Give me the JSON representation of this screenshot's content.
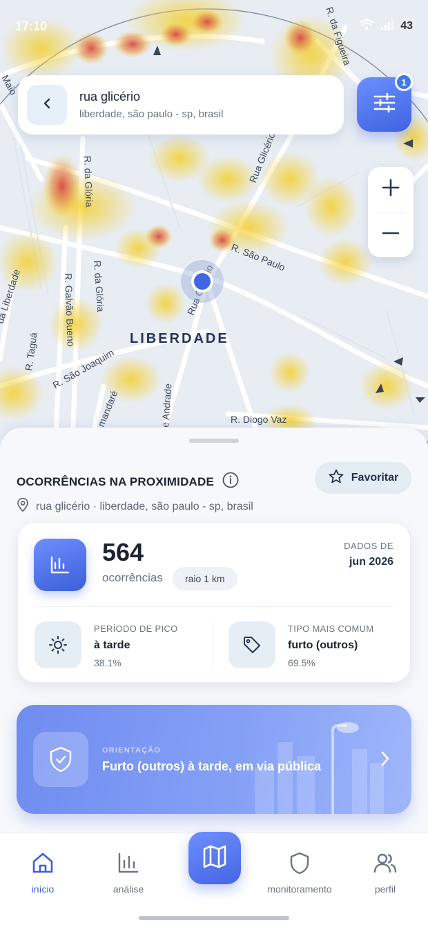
{
  "status": {
    "time": "17:10",
    "battery": "43"
  },
  "search": {
    "title": "rua glicério",
    "subtitle": "liberdade, são paulo - sp, brasil"
  },
  "filter": {
    "badge": "1"
  },
  "map": {
    "district": "LIBERDADE",
    "streets": [
      "R. da Figueira",
      "Maio",
      "R. da Glória",
      "Rua Glicério",
      "R. São Paulo",
      "Rua Glicério",
      "R. Galvão Bueno",
      "R. da Glória",
      "da Liberdade",
      "R. Taguá",
      "R. São Joaquim",
      "mandaré",
      "e Andrade",
      "R. Diogo Vaz"
    ]
  },
  "panel": {
    "title": "OCORRÊNCIAS NA PROXIMIDADE",
    "favorite_label": "Favoritar",
    "location": "rua glicério · liberdade, são paulo - sp, brasil",
    "count": "564",
    "count_label": "ocorrências",
    "radius": "raio 1 km",
    "data_label": "DADOS DE",
    "data_value": "jun 2026",
    "peak_label": "PERÍODO DE PICO",
    "peak_value": "à tarde",
    "peak_pct": "38.1%",
    "type_label": "TIPO MAIS COMUM",
    "type_value": "furto (outros)",
    "type_pct": "69.5%"
  },
  "orientation": {
    "label": "ORIENTAÇÃO",
    "text": "Furto (outros) à tarde, em via pública"
  },
  "nav": {
    "items": [
      {
        "label": "início"
      },
      {
        "label": "análise"
      },
      {
        "label": ""
      },
      {
        "label": "monitoramento"
      },
      {
        "label": "perfil"
      }
    ]
  },
  "colors": {
    "accent": "#4466e4",
    "active": "#3a5fd9",
    "heat_hot": "#d94a4a",
    "heat_warm": "#f3d23a"
  }
}
